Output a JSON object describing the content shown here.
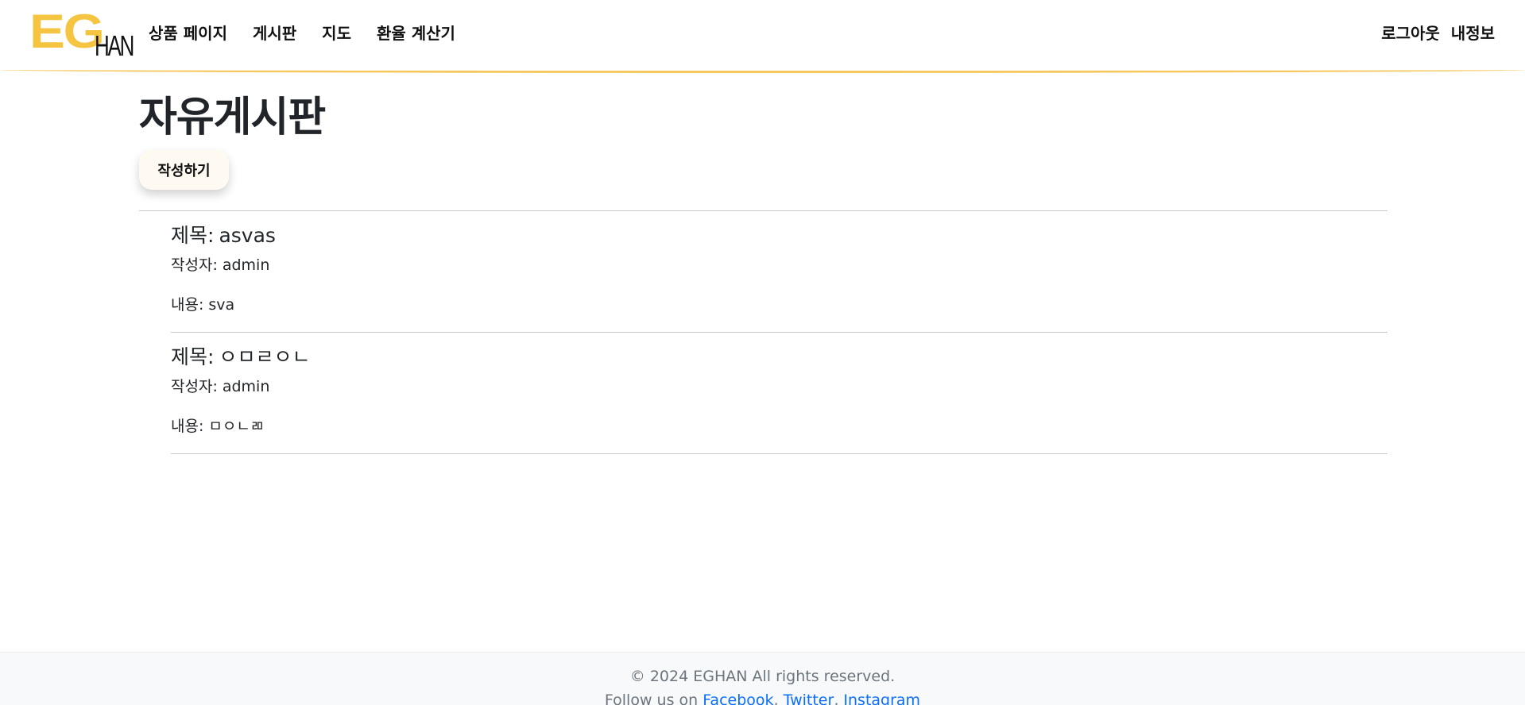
{
  "header": {
    "logo": {
      "main": "EG",
      "sub": "HAN"
    },
    "nav": [
      {
        "label": "상품 페이지"
      },
      {
        "label": "게시판"
      },
      {
        "label": "지도"
      },
      {
        "label": "환율 계산기"
      }
    ],
    "right": {
      "logout": "로그아웃",
      "profile": "내정보"
    }
  },
  "main": {
    "title": "자유게시판",
    "write_label": "작성하기",
    "posts": [
      {
        "title_label": "제목:",
        "title": "asvas",
        "author_label": "작성자:",
        "author": "admin",
        "content_label": "내용:",
        "content": "sva"
      },
      {
        "title_label": "제목:",
        "title": "ㅇㅁㄹㅇㄴ",
        "author_label": "작성자:",
        "author": "admin",
        "content_label": "내용:",
        "content": "ㅁㅇㄴㄻ"
      }
    ]
  },
  "footer": {
    "copyright": "© 2024 EGHAN All rights reserved.",
    "follow_text": "Follow us on",
    "links": [
      {
        "label": "Facebook"
      },
      {
        "label": "Twitter"
      },
      {
        "label": "Instagram"
      }
    ]
  },
  "colors": {
    "brand_yellow": "#f5c542",
    "header_border": "#f5c75c",
    "link_blue": "#0d6efd",
    "footer_bg": "#f8f9fa"
  }
}
